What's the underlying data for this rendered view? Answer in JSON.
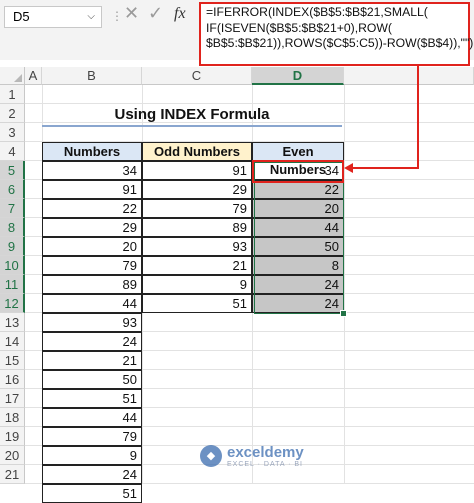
{
  "formula_bar": {
    "name_box": "D5",
    "cancel_icon": "✕",
    "enter_icon": "✓",
    "fx_label": "fx",
    "formula": "=IFERROR(INDEX($B$5:$B$21,SMALL(\nIF(ISEVEN($B$5:$B$21+0),ROW(\n$B$5:$B$21)),ROWS($C$5:C5))-ROW($B$4)),\"\")"
  },
  "columns": [
    "A",
    "B",
    "C",
    "D"
  ],
  "selected_column": "D",
  "rows": [
    "1",
    "2",
    "3",
    "4",
    "5",
    "6",
    "7",
    "8",
    "9",
    "10",
    "11",
    "12",
    "13",
    "14",
    "15",
    "16",
    "17",
    "18",
    "19",
    "20",
    "21"
  ],
  "selected_rows": [
    "5",
    "6",
    "7",
    "8",
    "9",
    "10",
    "11",
    "12"
  ],
  "sheet": {
    "title": "Using INDEX Formula",
    "headers": {
      "numbers": "Numbers",
      "odd": "Odd Numbers",
      "even": "Even Numbers"
    },
    "numbers": [
      "34",
      "91",
      "22",
      "29",
      "20",
      "79",
      "89",
      "44",
      "93",
      "24",
      "21",
      "50",
      "51",
      "44",
      "79",
      "9",
      "24",
      "51"
    ],
    "odd": [
      "91",
      "29",
      "79",
      "89",
      "93",
      "21",
      "9",
      "51"
    ],
    "even": [
      "34",
      "22",
      "20",
      "44",
      "50",
      "8",
      "24",
      "24"
    ]
  },
  "watermark": {
    "name": "exceldemy",
    "tagline": "EXCEL · DATA · BI"
  },
  "colors": {
    "accent_red": "#e0231d",
    "excel_green": "#217346",
    "header_blue": "#dbe7f5",
    "header_yellow": "#fff2cc"
  }
}
